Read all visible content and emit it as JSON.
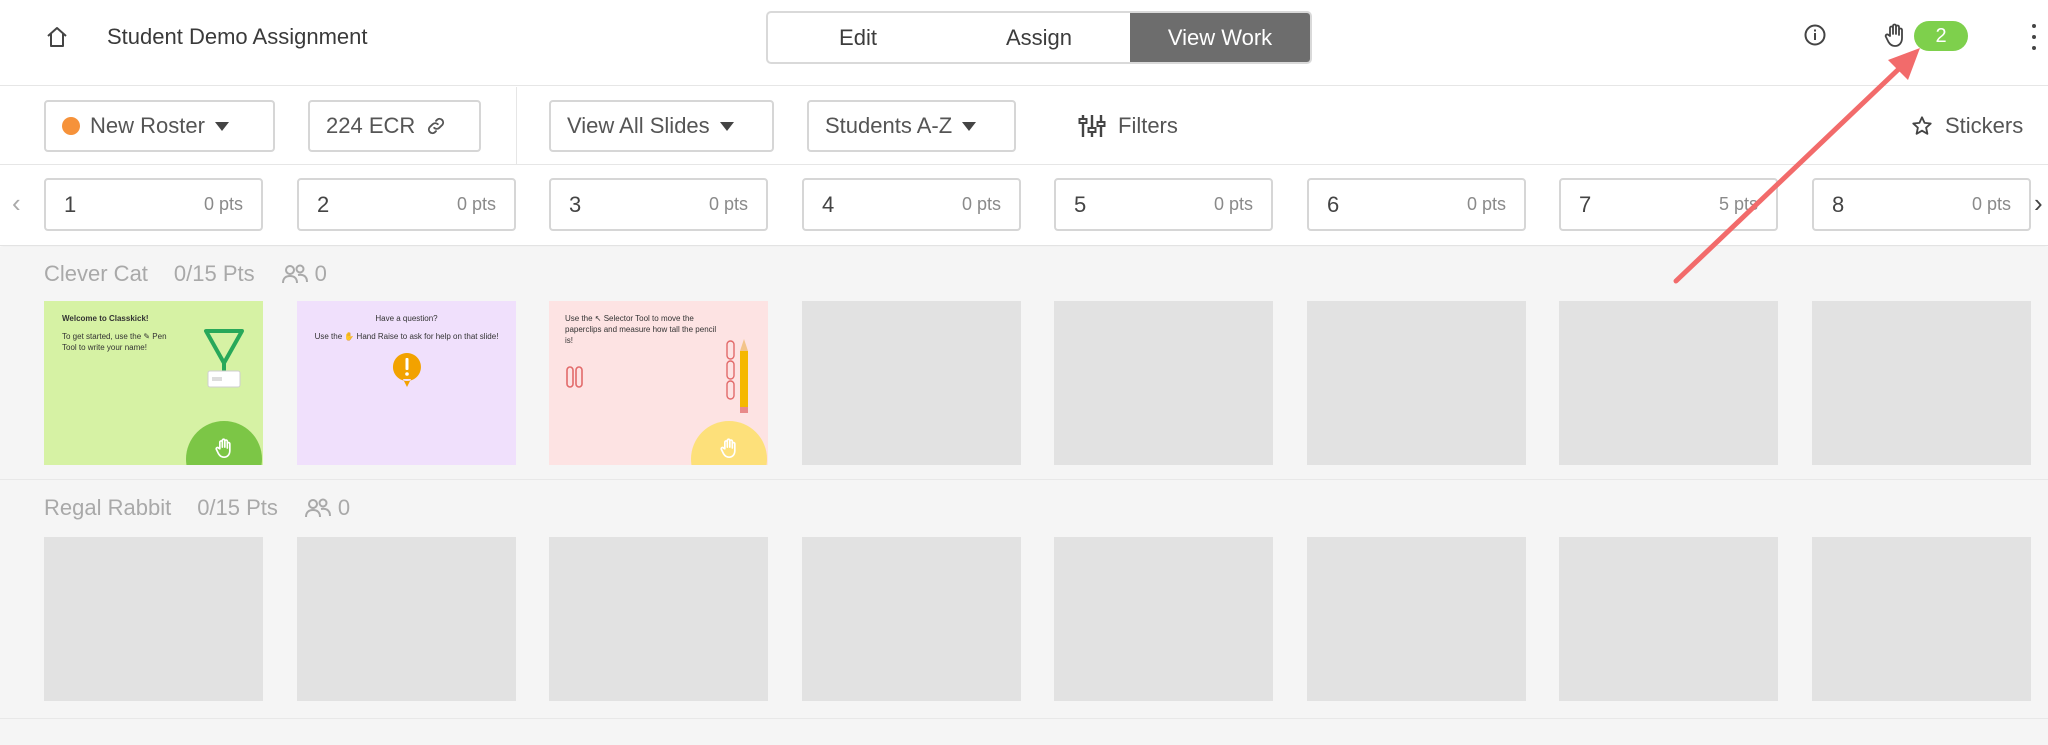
{
  "header": {
    "title": "Student Demo Assignment",
    "tabs": [
      "Edit",
      "Assign",
      "View Work"
    ],
    "active_tab": "View Work",
    "hand_raise_count": "2"
  },
  "toolbar": {
    "roster_label": "New Roster",
    "class_code": "224 ECR",
    "slides_filter": "View All Slides",
    "sort_label": "Students A-Z",
    "filters_label": "Filters",
    "stickers_label": "Stickers"
  },
  "slides": [
    {
      "num": "1",
      "pts": "0 pts"
    },
    {
      "num": "2",
      "pts": "0 pts"
    },
    {
      "num": "3",
      "pts": "0 pts"
    },
    {
      "num": "4",
      "pts": "0 pts"
    },
    {
      "num": "5",
      "pts": "0 pts"
    },
    {
      "num": "6",
      "pts": "0 pts"
    },
    {
      "num": "7",
      "pts": "5 pts"
    },
    {
      "num": "8",
      "pts": "0 pts"
    }
  ],
  "students": [
    {
      "name": "Clever Cat",
      "score": "0/15 Pts",
      "groups": "0"
    },
    {
      "name": "Regal Rabbit",
      "score": "0/15 Pts",
      "groups": "0"
    }
  ],
  "thumbnails": {
    "slide1_title": "Welcome to Classkick!",
    "slide1_body": "To get started, use the ✎ Pen Tool to write your name!",
    "slide2_title": "Have a question?",
    "slide2_body": "Use the ✋ Hand Raise to ask for help on that slide!",
    "slide3_body": "Use the ↖ Selector Tool to move the paperclips and measure how tall the pencil is!"
  },
  "colors": {
    "accent_green": "#7ed04c",
    "roster_dot": "#f6923a",
    "active_tab_bg": "#6d6d6d",
    "annotation_arrow": "#f26b6b",
    "help_circle_green": "#7cc646",
    "help_circle_yellow": "#fde07a"
  }
}
